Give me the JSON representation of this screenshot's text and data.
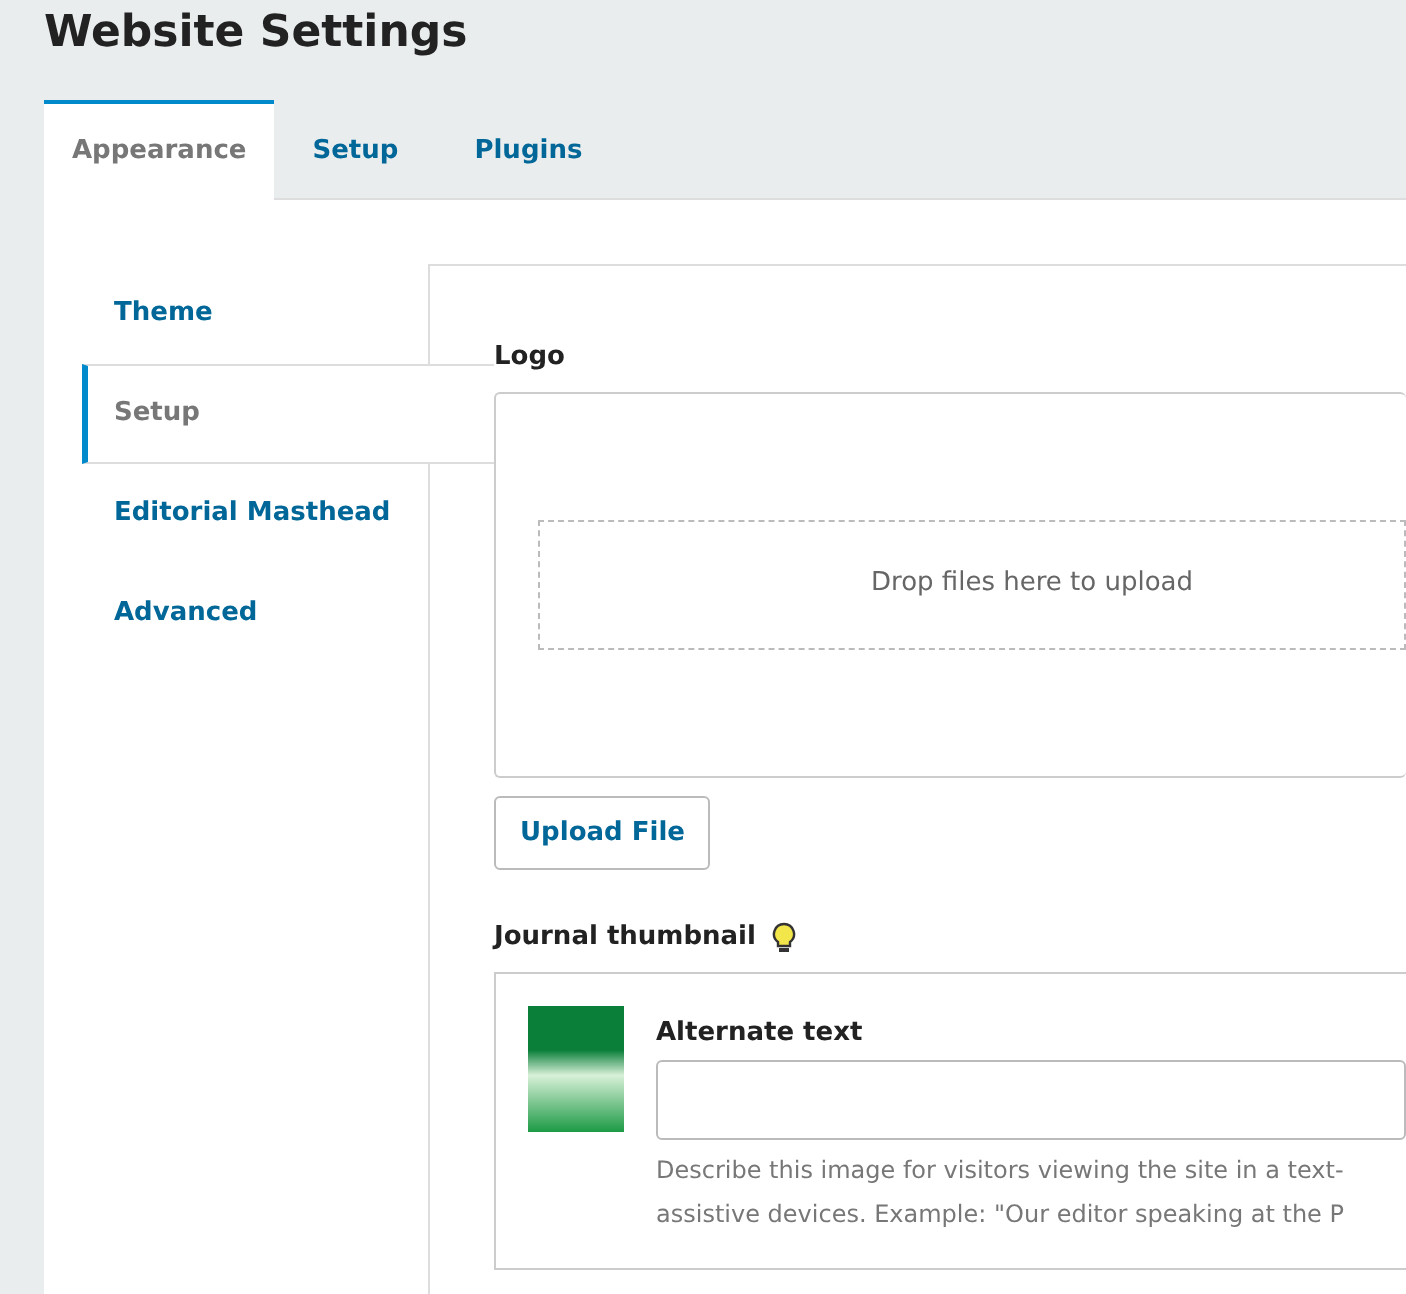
{
  "page_title": "Website Settings",
  "tabs": [
    {
      "label": "Appearance",
      "selected": true
    },
    {
      "label": "Setup",
      "selected": false
    },
    {
      "label": "Plugins",
      "selected": false
    }
  ],
  "side_nav": [
    {
      "label": "Theme",
      "selected": false
    },
    {
      "label": "Setup",
      "selected": true
    },
    {
      "label": "Editorial Masthead",
      "selected": false
    },
    {
      "label": "Advanced",
      "selected": false
    }
  ],
  "logo": {
    "label": "Logo",
    "dropzone_text": "Drop files here to upload",
    "upload_button": "Upload File"
  },
  "thumbnail": {
    "label": "Journal thumbnail",
    "alt_label": "Alternate text",
    "help_lines": [
      "Describe this image for visitors viewing the site in a text-",
      "assistive devices. Example: \"Our editor speaking at the P"
    ]
  }
}
